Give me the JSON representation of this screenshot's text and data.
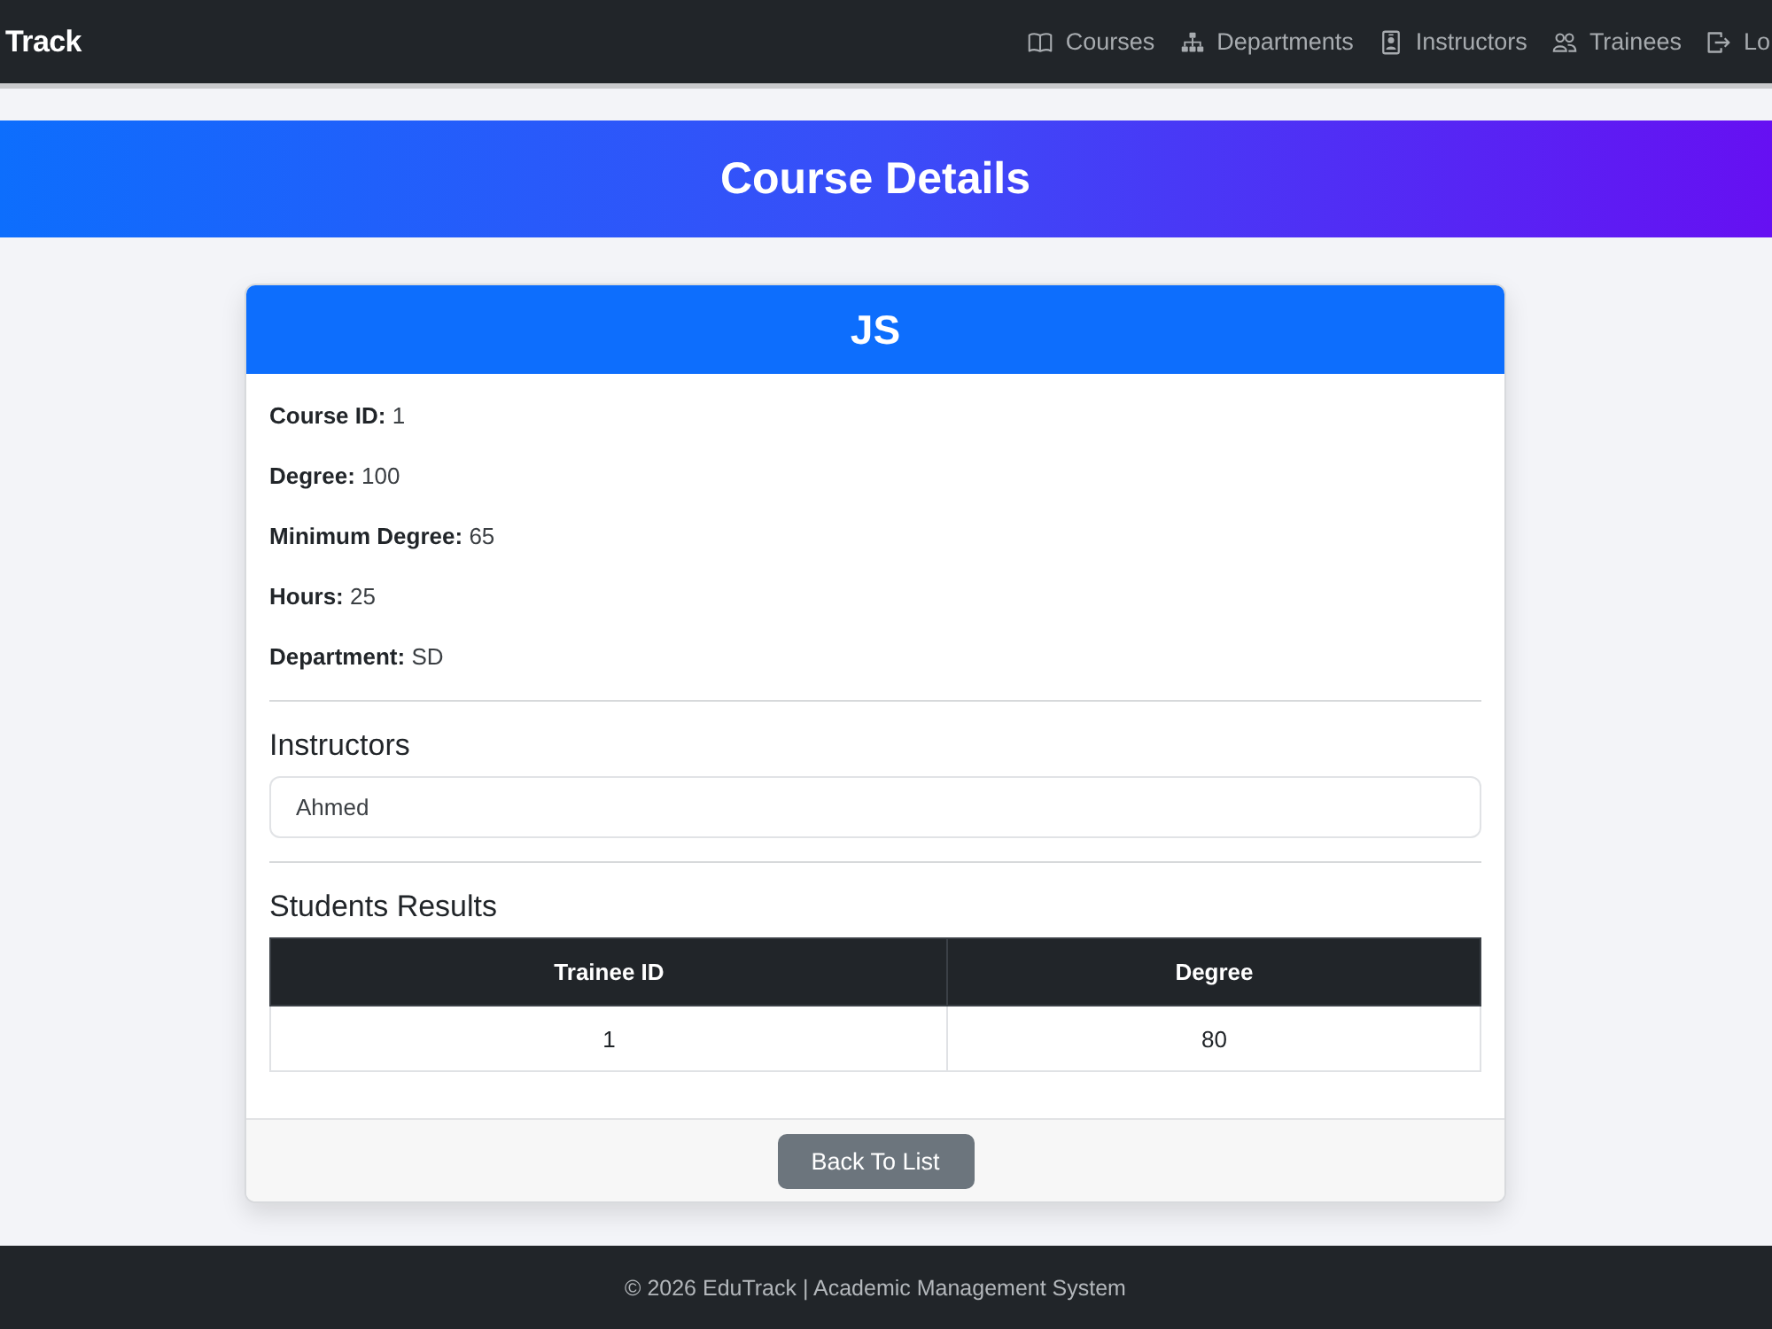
{
  "navbar": {
    "brand": "Track",
    "links": [
      {
        "label": "Courses"
      },
      {
        "label": "Departments"
      },
      {
        "label": "Instructors"
      },
      {
        "label": "Trainees"
      },
      {
        "label": "Lo"
      }
    ]
  },
  "banner": {
    "title": "Course Details"
  },
  "card": {
    "title": "JS",
    "fields": [
      {
        "label": "Course ID:",
        "value": "1"
      },
      {
        "label": "Degree:",
        "value": "100"
      },
      {
        "label": "Minimum Degree:",
        "value": "65"
      },
      {
        "label": "Hours:",
        "value": "25"
      },
      {
        "label": "Department:",
        "value": "SD"
      }
    ],
    "instructors": {
      "heading": "Instructors",
      "items": [
        "Ahmed"
      ]
    },
    "results": {
      "heading": "Students Results",
      "table": {
        "columns": [
          "Trainee ID",
          "Degree"
        ],
        "rows": [
          [
            "1",
            "80"
          ]
        ]
      }
    },
    "back_button": "Back To List"
  },
  "footer": {
    "text": "© 2026 EduTrack | Academic Management System"
  }
}
